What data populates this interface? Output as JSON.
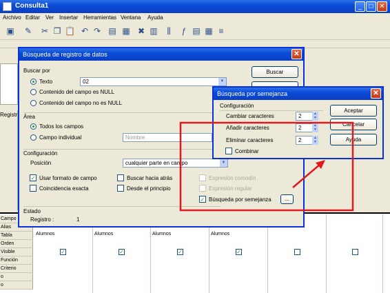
{
  "window": {
    "title": "Consulta1"
  },
  "menu": [
    "Archivo",
    "Editar",
    "Ver",
    "Insertar",
    "Herramientas",
    "Ventana",
    "Ayuda"
  ],
  "left_panel": {
    "registro_label": "Registr"
  },
  "grid": {
    "rows": [
      "Campo",
      "Alias",
      "Tabla",
      "Orden",
      "Visible",
      "Función",
      "Criterio",
      "o",
      "o"
    ],
    "table_value": "Alumnos"
  },
  "search_dialog": {
    "title": "Búsqueda de registro de datos",
    "buscar_por": "Buscar por",
    "texto_label": "Texto",
    "texto_value": "02",
    "contenido_null": "Contenido del campo es NULL",
    "contenido_no_null": "Contenido del campo no es NULL",
    "area_label": "Área",
    "todos_campos": "Todos los campos",
    "campo_individual": "Campo individual",
    "campo_value": "Nombre",
    "config_label": "Configuración",
    "posicion_label": "Posición",
    "posicion_value": "cualquier parte en campo",
    "usar_formato": "Usar formato de campo",
    "buscar_atras": "Buscar hacia atrás",
    "expr_comodin": "Expresión comodín",
    "coincidencia": "Coincidencia exacta",
    "desde_principio": "Desde el principio",
    "expr_regular": "Expresión regular",
    "busqueda_semejanza": "Búsqueda por semejanza",
    "ellipsis": "...",
    "estado_label": "Estado",
    "registro_label": "Registro :",
    "registro_value": "1",
    "buscar_button": "Buscar"
  },
  "similarity_dialog": {
    "title": "Búsqueda por semejanza",
    "config_label": "Configuración",
    "cambiar": "Cambiar caracteres",
    "cambiar_value": "2",
    "anadir": "Añadir caracteres",
    "anadir_value": "2",
    "eliminar": "Eliminar caracteres",
    "eliminar_value": "2",
    "combinar": "Combinar",
    "aceptar": "Aceptar",
    "cancelar": "Cancelar",
    "ayuda": "Ayuda"
  },
  "colors": {
    "annotation": "#e0191e",
    "titlebar": "#0a4bd6",
    "check": "#21a121"
  }
}
